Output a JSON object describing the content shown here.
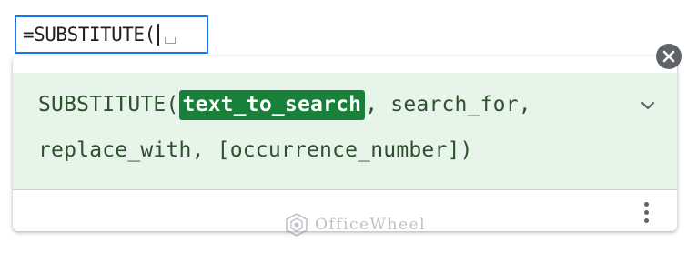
{
  "formula_cell": {
    "text": "=SUBSTITUTE("
  },
  "help_card": {
    "function_name": "SUBSTITUTE(",
    "active_param": "text_to_search",
    "line1_rest": ", search_for,",
    "line2": "replace_with, [occurrence_number])"
  },
  "icons": {
    "close": "close-icon",
    "expand": "chevron-down-icon",
    "more": "more-vert-icon"
  },
  "watermark": {
    "text": "OfficeWheel"
  },
  "colors": {
    "cell_border": "#1a73e8",
    "panel_bg": "#e6f4ea",
    "active_param_bg": "#188038",
    "close_bg": "#5f6368"
  }
}
